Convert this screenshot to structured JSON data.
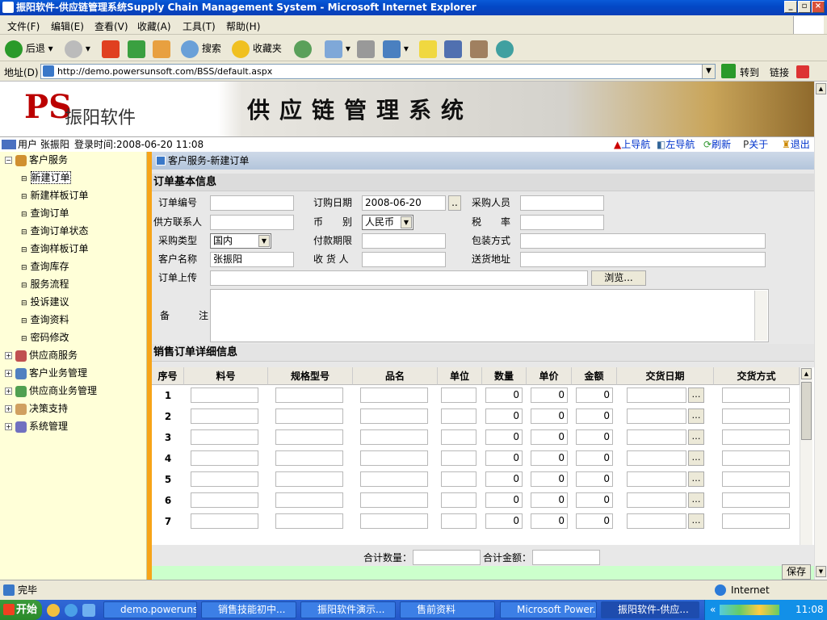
{
  "window": {
    "title": "振阳软件-供应链管理系统Supply Chain Management System - Microsoft Internet Explorer"
  },
  "menu": [
    "文件(F)",
    "编辑(E)",
    "查看(V)",
    "收藏(A)",
    "工具(T)",
    "帮助(H)"
  ],
  "toolbar": {
    "back": "后退",
    "search": "搜索",
    "favorites": "收藏夹"
  },
  "address": {
    "label": "地址(D)",
    "url": "http://demo.powersunsoft.com/BSS/default.aspx",
    "go": "转到",
    "links": "链接"
  },
  "banner": {
    "logo": "PS",
    "company": "振阳软件",
    "system_title": "供应链管理系统"
  },
  "info": {
    "user": "用户 张振阳",
    "login": "登录时间:2008-06-20 11:08",
    "nav_up": "上导航",
    "nav_left": "左导航",
    "refresh": "刷新",
    "about": "关于",
    "logout": "退出"
  },
  "sidebar": {
    "groups": [
      {
        "label": "客户服务",
        "expanded": true,
        "items": [
          "新建订单",
          "新建样板订单",
          "查询订单",
          "查询订单状态",
          "查询样板订单",
          "查询库存",
          "服务流程",
          "投诉建议",
          "查询资料",
          "密码修改"
        ]
      },
      {
        "label": "供应商服务",
        "expanded": false
      },
      {
        "label": "客户业务管理",
        "expanded": false
      },
      {
        "label": "供应商业务管理",
        "expanded": false
      },
      {
        "label": "决策支持",
        "expanded": false
      },
      {
        "label": "系统管理",
        "expanded": false
      }
    ],
    "selected": "新建订单"
  },
  "breadcrumb": "客户服务-新建订单",
  "order": {
    "section_title": "订单基本信息",
    "order_no_label": "订单编号",
    "order_no": "",
    "order_date_label": "订购日期",
    "order_date": "2008-06-20",
    "buyer_label": "采购人员",
    "buyer": "",
    "supplier_contact_label": "供方联系人",
    "supplier_contact": "",
    "currency_label": "币　别",
    "currency": "人民币",
    "tax_label": "税　率",
    "tax": "",
    "purchase_type_label": "采购类型",
    "purchase_type": "国内",
    "payment_label": "付款期限",
    "payment": "",
    "packing_label": "包装方式",
    "packing": "",
    "customer_label": "客户名称",
    "customer": "张振阳",
    "receiver_label": "收 货 人",
    "receiver": "",
    "address_label": "送货地址",
    "address": "",
    "upload_label": "订单上传",
    "browse": "浏览...",
    "remark_label": "备　注"
  },
  "detail": {
    "section_title": "销售订单详细信息",
    "columns": [
      "序号",
      "料号",
      "规格型号",
      "品名",
      "单位",
      "数量",
      "单价",
      "金额",
      "交货日期",
      "交货方式"
    ],
    "rows": [
      {
        "no": "1",
        "qty": "0",
        "price": "0",
        "amount": "0"
      },
      {
        "no": "2",
        "qty": "0",
        "price": "0",
        "amount": "0"
      },
      {
        "no": "3",
        "qty": "0",
        "price": "0",
        "amount": "0"
      },
      {
        "no": "4",
        "qty": "0",
        "price": "0",
        "amount": "0"
      },
      {
        "no": "5",
        "qty": "0",
        "price": "0",
        "amount": "0"
      },
      {
        "no": "6",
        "qty": "0",
        "price": "0",
        "amount": "0"
      },
      {
        "no": "7",
        "qty": "0",
        "price": "0",
        "amount": "0"
      }
    ],
    "total_qty_label": "合计数量：",
    "total_qty": "",
    "total_amount_label": "合计金额：",
    "total_amount": "",
    "save": "保存"
  },
  "status": {
    "text": "完毕",
    "zone": "Internet"
  },
  "taskbar": {
    "start": "开始",
    "tasks": [
      "demo.poweruns...",
      "销售技能初中...",
      "振阳软件演示...",
      "售前资料",
      "Microsoft Power...",
      "振阳软件-供应..."
    ],
    "clock": "11:08"
  },
  "colors": {
    "sidebar_bg": "#ffffd8",
    "divider": "#f7a418",
    "title_blue": "#0349c7",
    "link": "#0033cc"
  }
}
